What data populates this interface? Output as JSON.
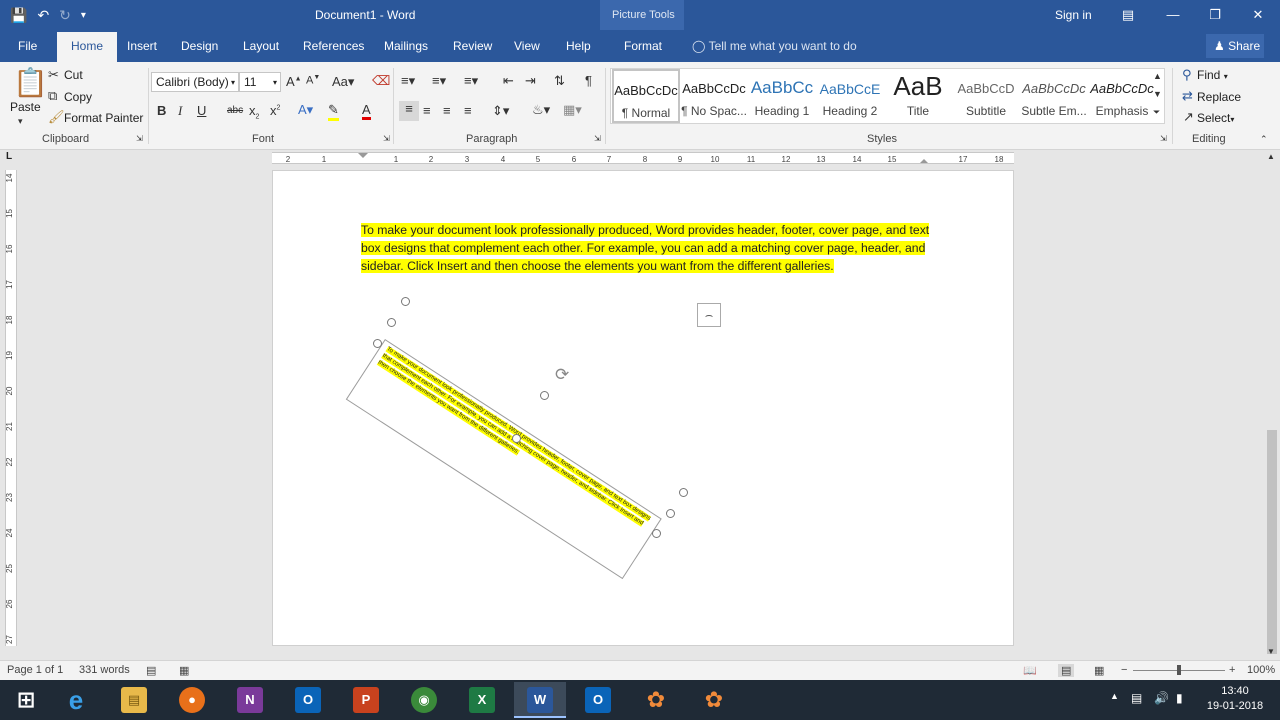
{
  "titlebar": {
    "doc_title": "Document1  -  Word",
    "context_label": "Picture Tools",
    "signin": "Sign in",
    "save_icon": "save-icon",
    "undo_icon": "undo-icon",
    "redo_icon": "redo-icon"
  },
  "tabs": {
    "file": "File",
    "home": "Home",
    "insert": "Insert",
    "design": "Design",
    "layout": "Layout",
    "references": "References",
    "mailings": "Mailings",
    "review": "Review",
    "view": "View",
    "help": "Help",
    "format": "Format",
    "tellme": "Tell me what you want to do",
    "share": "Share"
  },
  "clipboard": {
    "paste": "Paste",
    "cut": "Cut",
    "copy": "Copy",
    "format_painter": "Format Painter",
    "group": "Clipboard"
  },
  "font": {
    "name": "Calibri (Body)",
    "size": "11",
    "group": "Font"
  },
  "paragraph": {
    "group": "Paragraph"
  },
  "styles": {
    "group": "Styles",
    "items": [
      {
        "preview": "AaBbCcDc",
        "name": "¶ Normal"
      },
      {
        "preview": "AaBbCcDc",
        "name": "¶ No Spac..."
      },
      {
        "preview": "AaBbCc",
        "name": "Heading 1"
      },
      {
        "preview": "AaBbCcE",
        "name": "Heading 2"
      },
      {
        "preview": "AaB",
        "name": "Title"
      },
      {
        "preview": "AaBbCcD",
        "name": "Subtitle"
      },
      {
        "preview": "AaBbCcDc",
        "name": "Subtle Em..."
      },
      {
        "preview": "AaBbCcDc",
        "name": "Emphasis"
      }
    ]
  },
  "editing": {
    "find": "Find",
    "replace": "Replace",
    "select": "Select",
    "group": "Editing"
  },
  "document": {
    "paragraph": "To make your document look professionally produced, Word provides header, footer, cover page, and text box designs that complement each other. For example, you can add a matching cover page, header, and sidebar. Click Insert and then choose the elements you want from the different galleries.",
    "textbox_text": "To make your document look professionally produced, Word provides header, footer, cover page, and text box designs that complement each other. For example, you can add a matching cover page, header, and sidebar. Click Insert and then choose the elements you want from the different galleries."
  },
  "ruler": {
    "h_ticks": [
      "2",
      "1",
      "1",
      "2",
      "3",
      "4",
      "5",
      "6",
      "7",
      "8",
      "9",
      "10",
      "11",
      "12",
      "13",
      "14",
      "15",
      "17",
      "18"
    ],
    "v_ticks": [
      "14",
      "15",
      "16",
      "17",
      "18",
      "19",
      "20",
      "21",
      "22",
      "23",
      "24",
      "25",
      "26",
      "27"
    ]
  },
  "status": {
    "page": "Page 1 of 1",
    "words": "331 words",
    "zoom": "100%"
  },
  "clock": {
    "time": "13:40",
    "date": "19-01-2018"
  },
  "colors": {
    "word_blue": "#2b579a",
    "highlight": "#ffff00"
  }
}
